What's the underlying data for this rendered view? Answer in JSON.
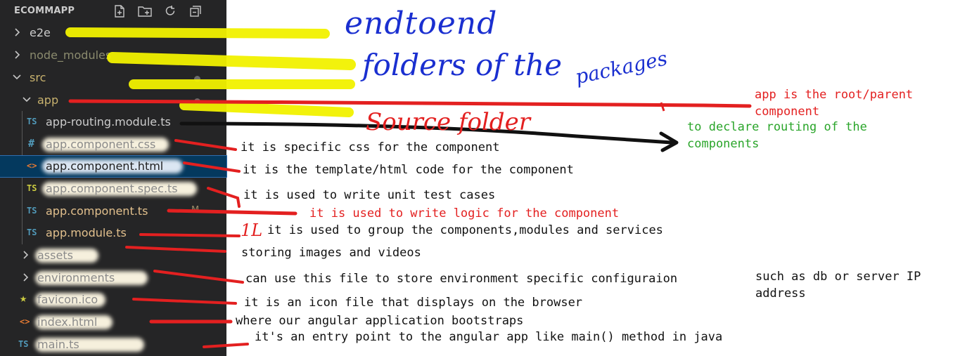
{
  "explorer": {
    "title": "ECOMMAPP",
    "actions": [
      {
        "name": "new-file-icon"
      },
      {
        "name": "new-folder-icon"
      },
      {
        "name": "refresh-icon"
      },
      {
        "name": "collapse-all-icon"
      }
    ],
    "items": [
      {
        "label": "e2e",
        "type": "folder",
        "expanded": false
      },
      {
        "label": "node_modules",
        "type": "folder",
        "expanded": false
      },
      {
        "label": "src",
        "type": "folder",
        "expanded": true
      },
      {
        "label": "app",
        "type": "folder",
        "expanded": true
      },
      {
        "label": "app-routing.module.ts",
        "type": "ts",
        "icon": "TS"
      },
      {
        "label": "app.component.css",
        "type": "css",
        "icon": "#"
      },
      {
        "label": "app.component.html",
        "type": "html",
        "icon": "<>"
      },
      {
        "label": "app.component.spec.ts",
        "type": "spec",
        "icon": "TS"
      },
      {
        "label": "app.component.ts",
        "type": "ts",
        "icon": "TS",
        "badge": "M"
      },
      {
        "label": "app.module.ts",
        "type": "ts",
        "icon": "TS"
      },
      {
        "label": "assets",
        "type": "folder",
        "expanded": false
      },
      {
        "label": "environments",
        "type": "folder",
        "expanded": false
      },
      {
        "label": "favicon.ico",
        "type": "ico",
        "icon": "★"
      },
      {
        "label": "index.html",
        "type": "html",
        "icon": "<>"
      },
      {
        "label": "main.ts",
        "type": "ts",
        "icon": "TS"
      }
    ]
  },
  "annotations": {
    "css": "it is specific css for the component",
    "html": "it is the template/html code for the component",
    "spec": "it is used to write unit test cases",
    "ts": "it is used to write logic for the component",
    "module_mark": "1L",
    "module": "it is used to group the components,modules and services",
    "assets": "storing images and videos",
    "environments": "can use this file to store environment specific configuraion",
    "environments_cont_1": "such as db or server IP",
    "environments_cont_2": "address",
    "favicon": "it is an icon file that displays on the browser",
    "index": "where our angular application bootstraps",
    "main": "it's an entry point to the angular app like main() method in java",
    "app_root_1": "app is the root/parent",
    "app_root_2": "component",
    "routing_1": "to declare routing of the",
    "routing_2": "components"
  },
  "handwriting": {
    "e2e": "endtoend",
    "node_modules_1": "folders of the",
    "node_modules_2": "packages",
    "src": "Source folder"
  },
  "colors": {
    "explorer_bg": "#252526",
    "selection": "#04395e",
    "highlighter": "#f5f500",
    "marker_red": "#e32020",
    "marker_blue": "#1a2fd0",
    "annotation_green": "#2aa52a",
    "ts_icon": "#519aba",
    "spec_icon": "#cbcb41",
    "html_icon": "#e37933",
    "folder_text": "#cccccc",
    "git_text": "#c8b26e"
  }
}
